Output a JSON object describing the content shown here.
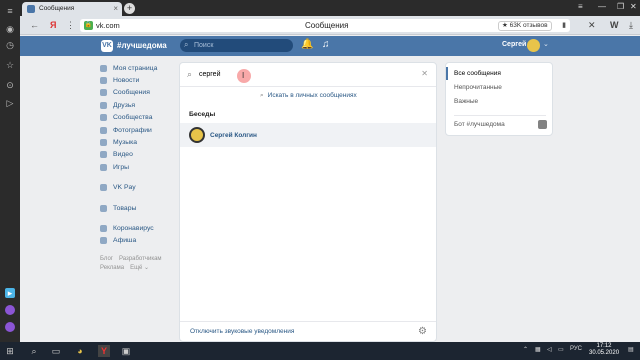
{
  "browser": {
    "tab_title": "Сообщения",
    "new_tab_label": "+",
    "url": "vk.com",
    "page_title": "Сообщения",
    "reviews": "★ 63K отзывов"
  },
  "vk": {
    "community": "#лучшедома",
    "search_placeholder": "Поиск",
    "user_name": "Сергей"
  },
  "menu": {
    "items": [
      {
        "label": "Моя страница",
        "icon": "home-icon"
      },
      {
        "label": "Новости",
        "icon": "news-icon"
      },
      {
        "label": "Сообщения",
        "icon": "messages-icon"
      },
      {
        "label": "Друзья",
        "icon": "friends-icon"
      },
      {
        "label": "Сообщества",
        "icon": "groups-icon"
      },
      {
        "label": "Фотографии",
        "icon": "photos-icon"
      },
      {
        "label": "Музыка",
        "icon": "music-icon"
      },
      {
        "label": "Видео",
        "icon": "video-icon"
      },
      {
        "label": "Игры",
        "icon": "games-icon"
      }
    ],
    "vkpay": "VK Pay",
    "goods": "Товары",
    "extra": [
      "Коронавирус",
      "Афиша"
    ],
    "footer": [
      "Блог",
      "Разработчикам",
      "Реклама",
      "Ещё ⌄"
    ]
  },
  "messages": {
    "search_value": "сергей",
    "search_private": "Искать в личных сообщениях",
    "section_title": "Беседы",
    "conversations": [
      {
        "name": "Сергей Колгин"
      }
    ],
    "disable_sounds": "Отключить звуковые уведомления"
  },
  "filters": {
    "items": [
      "Все сообщения",
      "Непрочитанные",
      "Важные"
    ],
    "bot": "Бот #лучшедома"
  },
  "taskbar": {
    "lang": "РУС",
    "time": "17:12",
    "date": "30.05.2020"
  },
  "colors": {
    "vk_blue": "#4a76a8",
    "link": "#2a5885",
    "background": "#edeef0"
  }
}
